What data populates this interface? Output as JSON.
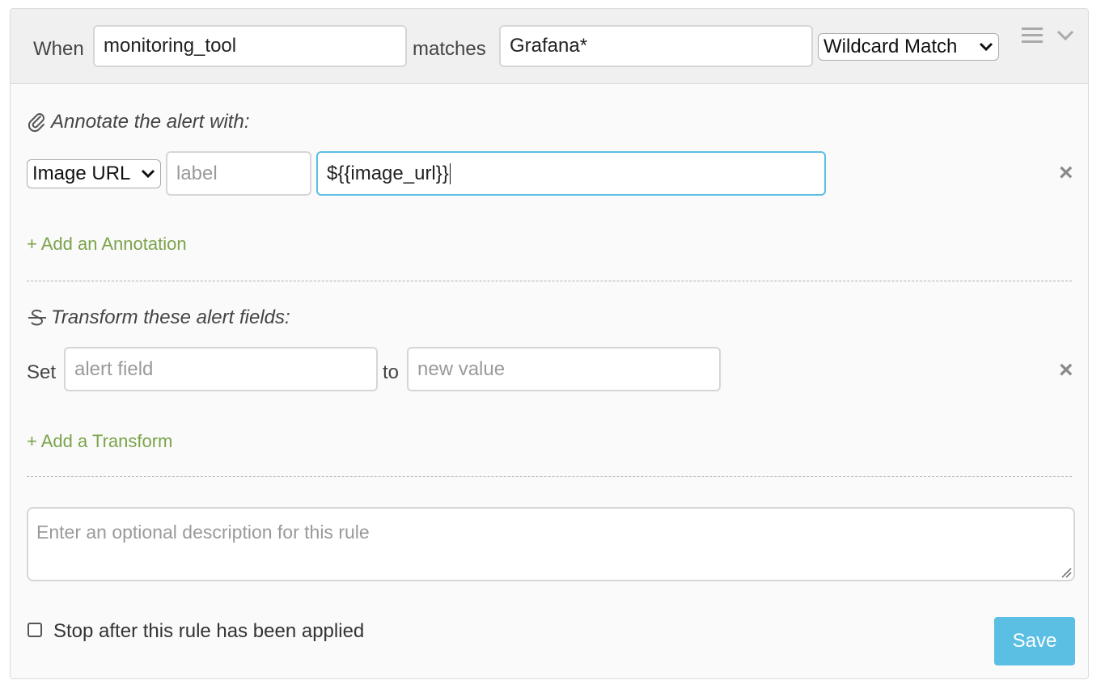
{
  "rule": {
    "when_label": "When",
    "field_value": "monitoring_tool",
    "matches_label": "matches",
    "pattern_value": "Grafana*",
    "match_type": "Wildcard Match"
  },
  "header_icons": {
    "menu": "hamburger-icon",
    "collapse": "chevron-down-icon"
  },
  "annotate": {
    "title": "Annotate the alert with:",
    "icon": "paperclip-icon",
    "type_selected": "Image URL",
    "label_placeholder": "label",
    "value": "${{image_url}}",
    "remove": "×",
    "add_link": "+ Add an Annotation"
  },
  "transform": {
    "title": "Transform these alert fields:",
    "icon": "strikethrough-icon",
    "set_label": "Set",
    "field_placeholder": "alert field",
    "to_label": "to",
    "value_placeholder": "new value",
    "remove": "×",
    "add_link": "+ Add a Transform"
  },
  "description": {
    "placeholder": "Enter an optional description for this rule"
  },
  "stop": {
    "label": "Stop after this rule has been applied",
    "checked": false
  },
  "save_label": "Save",
  "colors": {
    "accent": "#5bbfe3",
    "link": "#7ba34a",
    "focus_border": "#5bbfe3"
  }
}
